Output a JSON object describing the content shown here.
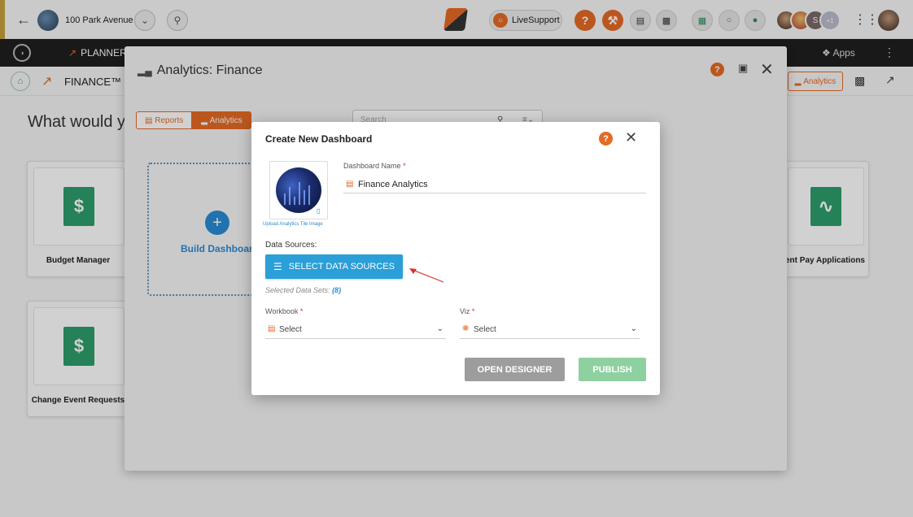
{
  "topbar": {
    "back_icon": "arrow-left-icon",
    "project_name": "100 Park Avenue",
    "live_support_label": "LiveSupport",
    "user_overflow": "+1"
  },
  "darknav": {
    "module_label": "PLANNER",
    "apps_label": "Apps"
  },
  "breadcrumb": {
    "module_label": "FINANCE™",
    "analytics_label": "Analytics"
  },
  "background": {
    "heading": "What would yo",
    "apps": [
      {
        "label": "Budget Manager"
      },
      {
        "label": "Change Event Requests"
      },
      {
        "label": "ent Pay Applications"
      }
    ]
  },
  "panel": {
    "title": "Analytics: Finance",
    "tabs": [
      {
        "label": "Reports",
        "active": false
      },
      {
        "label": "Analytics",
        "active": true
      }
    ],
    "search_placeholder": "Search",
    "build_label": "Build Dashboard"
  },
  "dialog": {
    "title": "Create New Dashboard",
    "upload_caption": "Upload Analytics Tile Image",
    "name_label": "Dashboard Name",
    "name_value": "Finance Analytics",
    "data_sources_label": "Data Sources:",
    "select_sources_button": "SELECT DATA SOURCES",
    "selected_sets_label": "Selected Data Sets:",
    "selected_sets_count": "(8)",
    "workbook_label": "Workbook",
    "workbook_value": "Select",
    "viz_label": "Viz",
    "viz_value": "Select",
    "open_designer_button": "OPEN DESIGNER",
    "publish_button": "PUBLISH",
    "required_marker": "*"
  },
  "colors": {
    "brand_orange": "#e46b25",
    "primary_blue": "#2a9fd8",
    "publish_green": "#8fd0a0",
    "app_green": "#2e9e6b"
  }
}
